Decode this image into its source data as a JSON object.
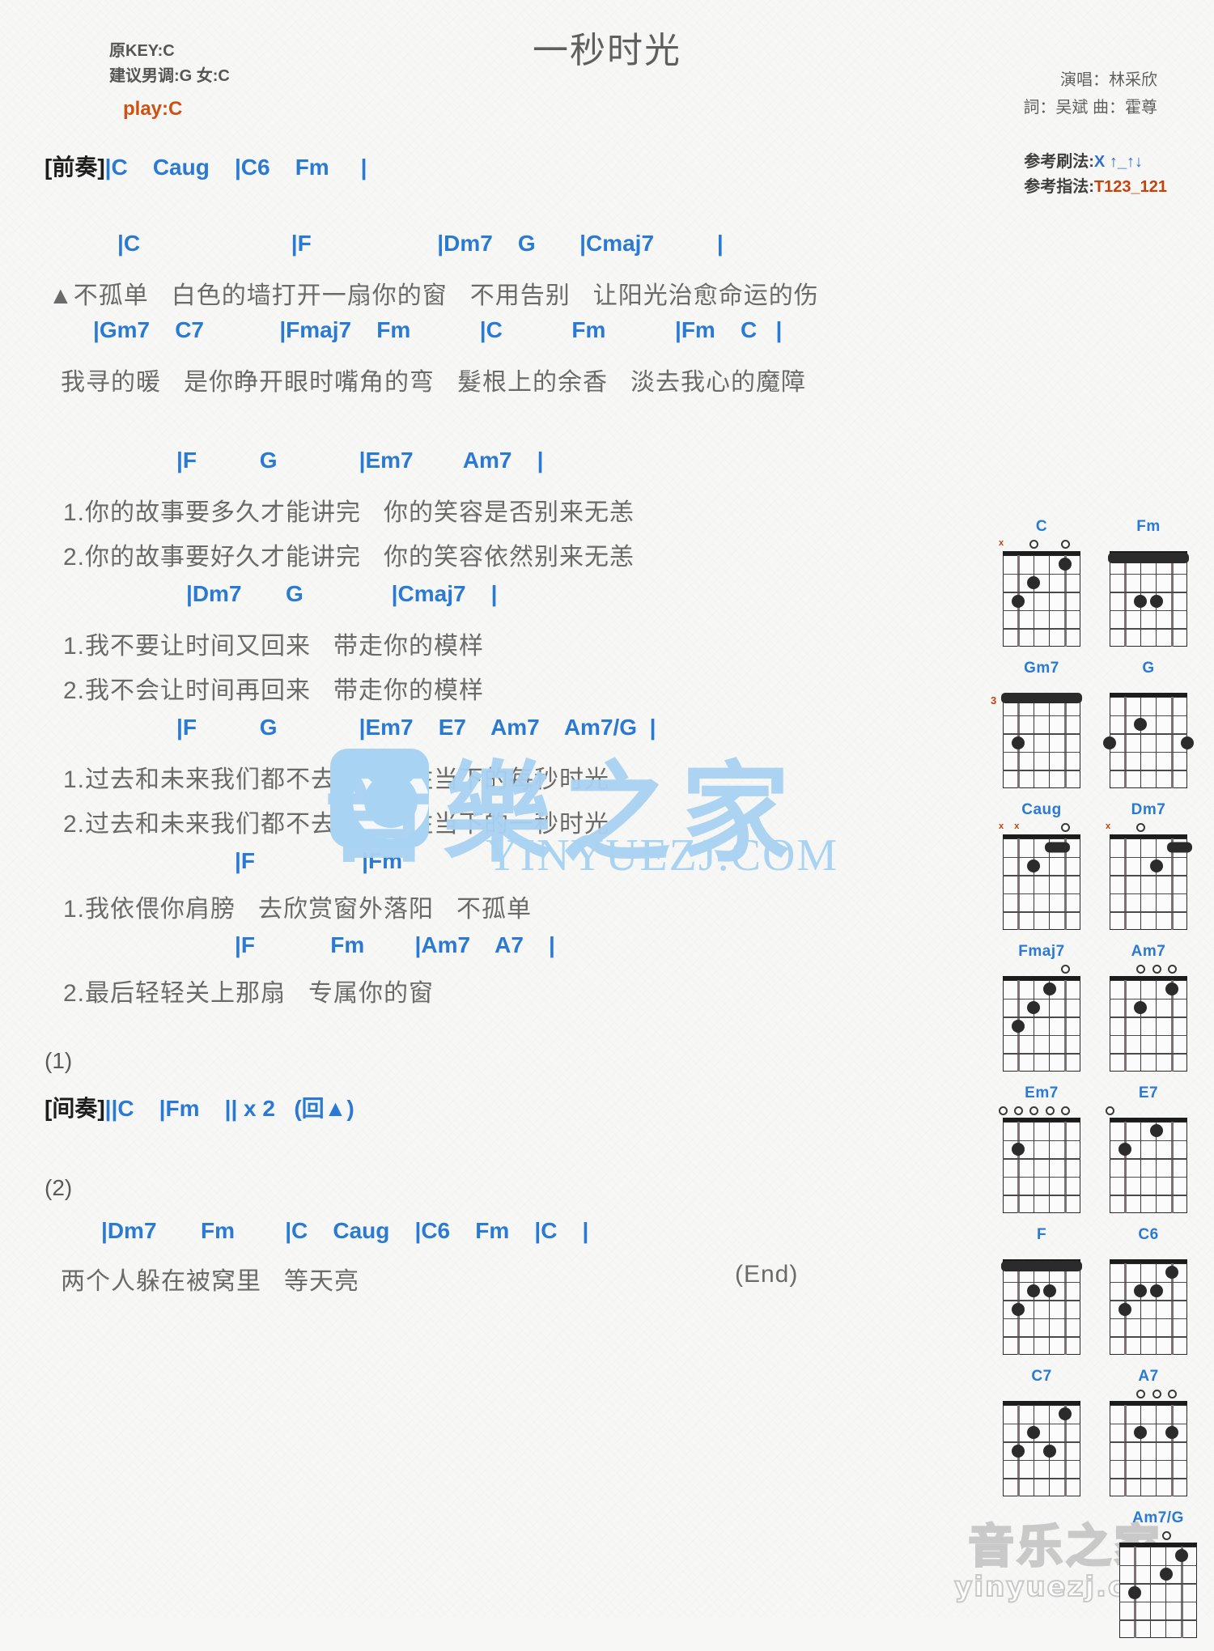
{
  "header": {
    "orig_key": "原KEY:C",
    "suggest_key": "建议男调:G 女:C",
    "play_key": "play:C",
    "title": "一秒时光",
    "singer": "演唱：林采欣",
    "writer": "詞：吴斌  曲：霍尊",
    "strum_label": "参考刷法:",
    "strum_value": "X ↑_↑↓",
    "finger_label": "参考指法:",
    "finger_value": "T123_121"
  },
  "colors": {
    "chord_blue": "#2a7ad4",
    "bar_orange": "#c2420b",
    "lyric_gray": "#6a6a6a",
    "title_gray": "#5f5f5f",
    "watermark_blue": "#a9d3f2"
  },
  "sections": {
    "intro_tag": "[前奏]",
    "intro_chords": "|C    Caug    |C6    Fm     |",
    "v1_chords": "|C                        |F                    |Dm7    G       |Cmaj7          |",
    "v1_lyric": "▲不孤单   白色的墙打开一扇你的窗   不用告别   让阳光治愈命运的伤",
    "v2_chords": "|Gm7    C7            |Fmaj7    Fm           |C           Fm           |Fm    C   |",
    "v2_lyric": "我寻的暖   是你睁开眼时嘴角的弯   髮根上的余香   淡去我心的魔障",
    "c1_chords": "|F          G             |Em7        Am7    |",
    "c1_lyric_1": "1.你的故事要多久才能讲完   你的笑容是否别来无恙",
    "c1_lyric_2": "2.你的故事要好久才能讲完   你的笑容依然别来无恙",
    "c2_chords": "|Dm7       G              |Cmaj7    |",
    "c2_lyric_1": "1.我不要让时间又回来   带走你的模样",
    "c2_lyric_2": "2.我不会让时间再回来   带走你的模样",
    "c3_chords": "|F          G             |Em7    E7    Am7    Am7/G  |",
    "c3_lyric_1": "1.过去和未来我们都不去想   留住当下的每秒时光",
    "c3_lyric_2": "2.过去和未来我们都不去想   留住当下的一秒时光",
    "c4_chords": "|F                 |Fm",
    "c4_lyric_1": "1.我依偎你肩膀   去欣赏窗外落阳   不孤单",
    "c5_chords": "|F            Fm        |Am7    A7    |",
    "c5_lyric_2": "2.最后轻轻关上那扇   专属你的窗",
    "ending1_num": "(1)",
    "interlude_tag": "[间奏]",
    "interlude_chords": "||C    |Fm    || x 2   (回▲)",
    "ending2_num": "(2)",
    "end_chords": "|Dm7       Fm        |C    Caug    |C6    Fm    |C    |",
    "end_lyric": "两个人躲在被窝里   等天亮",
    "end_mark": "(End)"
  },
  "watermark": {
    "center_text": "YINYUEZJ.COM",
    "bottom_cn": "音乐之家",
    "bottom_en": "yinyuezj.com"
  },
  "chord_diagrams": [
    {
      "name": "C",
      "base": 0,
      "open": [
        {
          "sym": "x",
          "str": 0
        },
        {
          "sym": "o",
          "str": 2
        },
        {
          "sym": "o",
          "str": 4
        }
      ],
      "dots": [
        {
          "s": 1,
          "f": 3
        },
        {
          "s": 2,
          "f": 2
        },
        {
          "s": 4,
          "f": 1
        }
      ],
      "barres": [],
      "nut": true
    },
    {
      "name": "Fm",
      "base": 0,
      "open": [],
      "dots": [
        {
          "s": 2,
          "f": 3
        },
        {
          "s": 3,
          "f": 3
        }
      ],
      "barres": [],
      "nut": true,
      "fullbarre": true
    },
    {
      "name": "Gm7",
      "base": 3,
      "open": [],
      "dots": [
        {
          "s": 1,
          "f": 3
        }
      ],
      "barres": [],
      "nut": false,
      "fullbarre": true
    },
    {
      "name": "G",
      "base": 0,
      "open": [],
      "dots": [
        {
          "s": 0,
          "f": 3
        },
        {
          "s": 2,
          "f": 2
        },
        {
          "s": 5,
          "f": 3
        }
      ],
      "barres": [],
      "nut": true
    },
    {
      "name": "Caug",
      "base": 0,
      "open": [
        {
          "sym": "x",
          "str": 0
        },
        {
          "sym": "x",
          "str": 1
        },
        {
          "sym": "o",
          "str": 4
        }
      ],
      "dots": [
        {
          "s": 2,
          "f": 2
        }
      ],
      "barres": [
        {
          "from": 3,
          "to": 4,
          "f": 1
        }
      ],
      "nut": true
    },
    {
      "name": "Dm7",
      "base": 0,
      "open": [
        {
          "sym": "x",
          "str": 0
        },
        {
          "sym": "o",
          "str": 2
        }
      ],
      "dots": [
        {
          "s": 3,
          "f": 2
        }
      ],
      "barres": [
        {
          "from": 4,
          "to": 5,
          "f": 1
        }
      ],
      "nut": true
    },
    {
      "name": "Fmaj7",
      "base": 0,
      "open": [
        {
          "sym": "o",
          "str": 4
        }
      ],
      "dots": [
        {
          "s": 1,
          "f": 3
        },
        {
          "s": 2,
          "f": 2
        },
        {
          "s": 3,
          "f": 1
        }
      ],
      "barres": [],
      "nut": true
    },
    {
      "name": "Am7",
      "base": 0,
      "open": [
        {
          "sym": "o",
          "str": 2
        },
        {
          "sym": "o",
          "str": 3
        },
        {
          "sym": "o",
          "str": 4
        }
      ],
      "dots": [
        {
          "s": 2,
          "f": 2
        },
        {
          "s": 4,
          "f": 1
        }
      ],
      "barres": [],
      "nut": true
    },
    {
      "name": "Em7",
      "base": 0,
      "open": [
        {
          "sym": "o",
          "str": 0
        },
        {
          "sym": "o",
          "str": 1
        },
        {
          "sym": "o",
          "str": 2
        },
        {
          "sym": "o",
          "str": 3
        },
        {
          "sym": "o",
          "str": 4
        }
      ],
      "dots": [
        {
          "s": 1,
          "f": 2
        }
      ],
      "barres": [],
      "nut": true
    },
    {
      "name": "E7",
      "base": 0,
      "open": [
        {
          "sym": "o",
          "str": 0
        }
      ],
      "dots": [
        {
          "s": 1,
          "f": 2
        },
        {
          "s": 3,
          "f": 1
        }
      ],
      "barres": [],
      "nut": true
    },
    {
      "name": "F",
      "base": 0,
      "open": [],
      "dots": [
        {
          "s": 2,
          "f": 2
        },
        {
          "s": 3,
          "f": 2
        },
        {
          "s": 1,
          "f": 3
        }
      ],
      "barres": [],
      "nut": true,
      "fullbarre": true
    },
    {
      "name": "C6",
      "base": 0,
      "open": [],
      "dots": [
        {
          "s": 4,
          "f": 1
        },
        {
          "s": 2,
          "f": 2
        },
        {
          "s": 3,
          "f": 2
        },
        {
          "s": 1,
          "f": 3
        }
      ],
      "barres": [],
      "nut": true
    },
    {
      "name": "C7",
      "base": 0,
      "open": [],
      "dots": [
        {
          "s": 4,
          "f": 1
        },
        {
          "s": 2,
          "f": 2
        },
        {
          "s": 1,
          "f": 3
        },
        {
          "s": 3,
          "f": 3
        }
      ],
      "barres": [],
      "nut": true
    },
    {
      "name": "A7",
      "base": 0,
      "open": [
        {
          "sym": "o",
          "str": 2
        },
        {
          "sym": "o",
          "str": 3
        },
        {
          "sym": "o",
          "str": 4
        }
      ],
      "dots": [
        {
          "s": 2,
          "f": 2
        },
        {
          "s": 4,
          "f": 2
        }
      ],
      "barres": [],
      "nut": true
    },
    {
      "name": "Am7/G",
      "base": 0,
      "open": [
        {
          "sym": "o",
          "str": 3
        }
      ],
      "dots": [
        {
          "s": 4,
          "f": 1
        },
        {
          "s": 3,
          "f": 2
        },
        {
          "s": 1,
          "f": 3
        }
      ],
      "barres": [],
      "nut": true
    }
  ]
}
